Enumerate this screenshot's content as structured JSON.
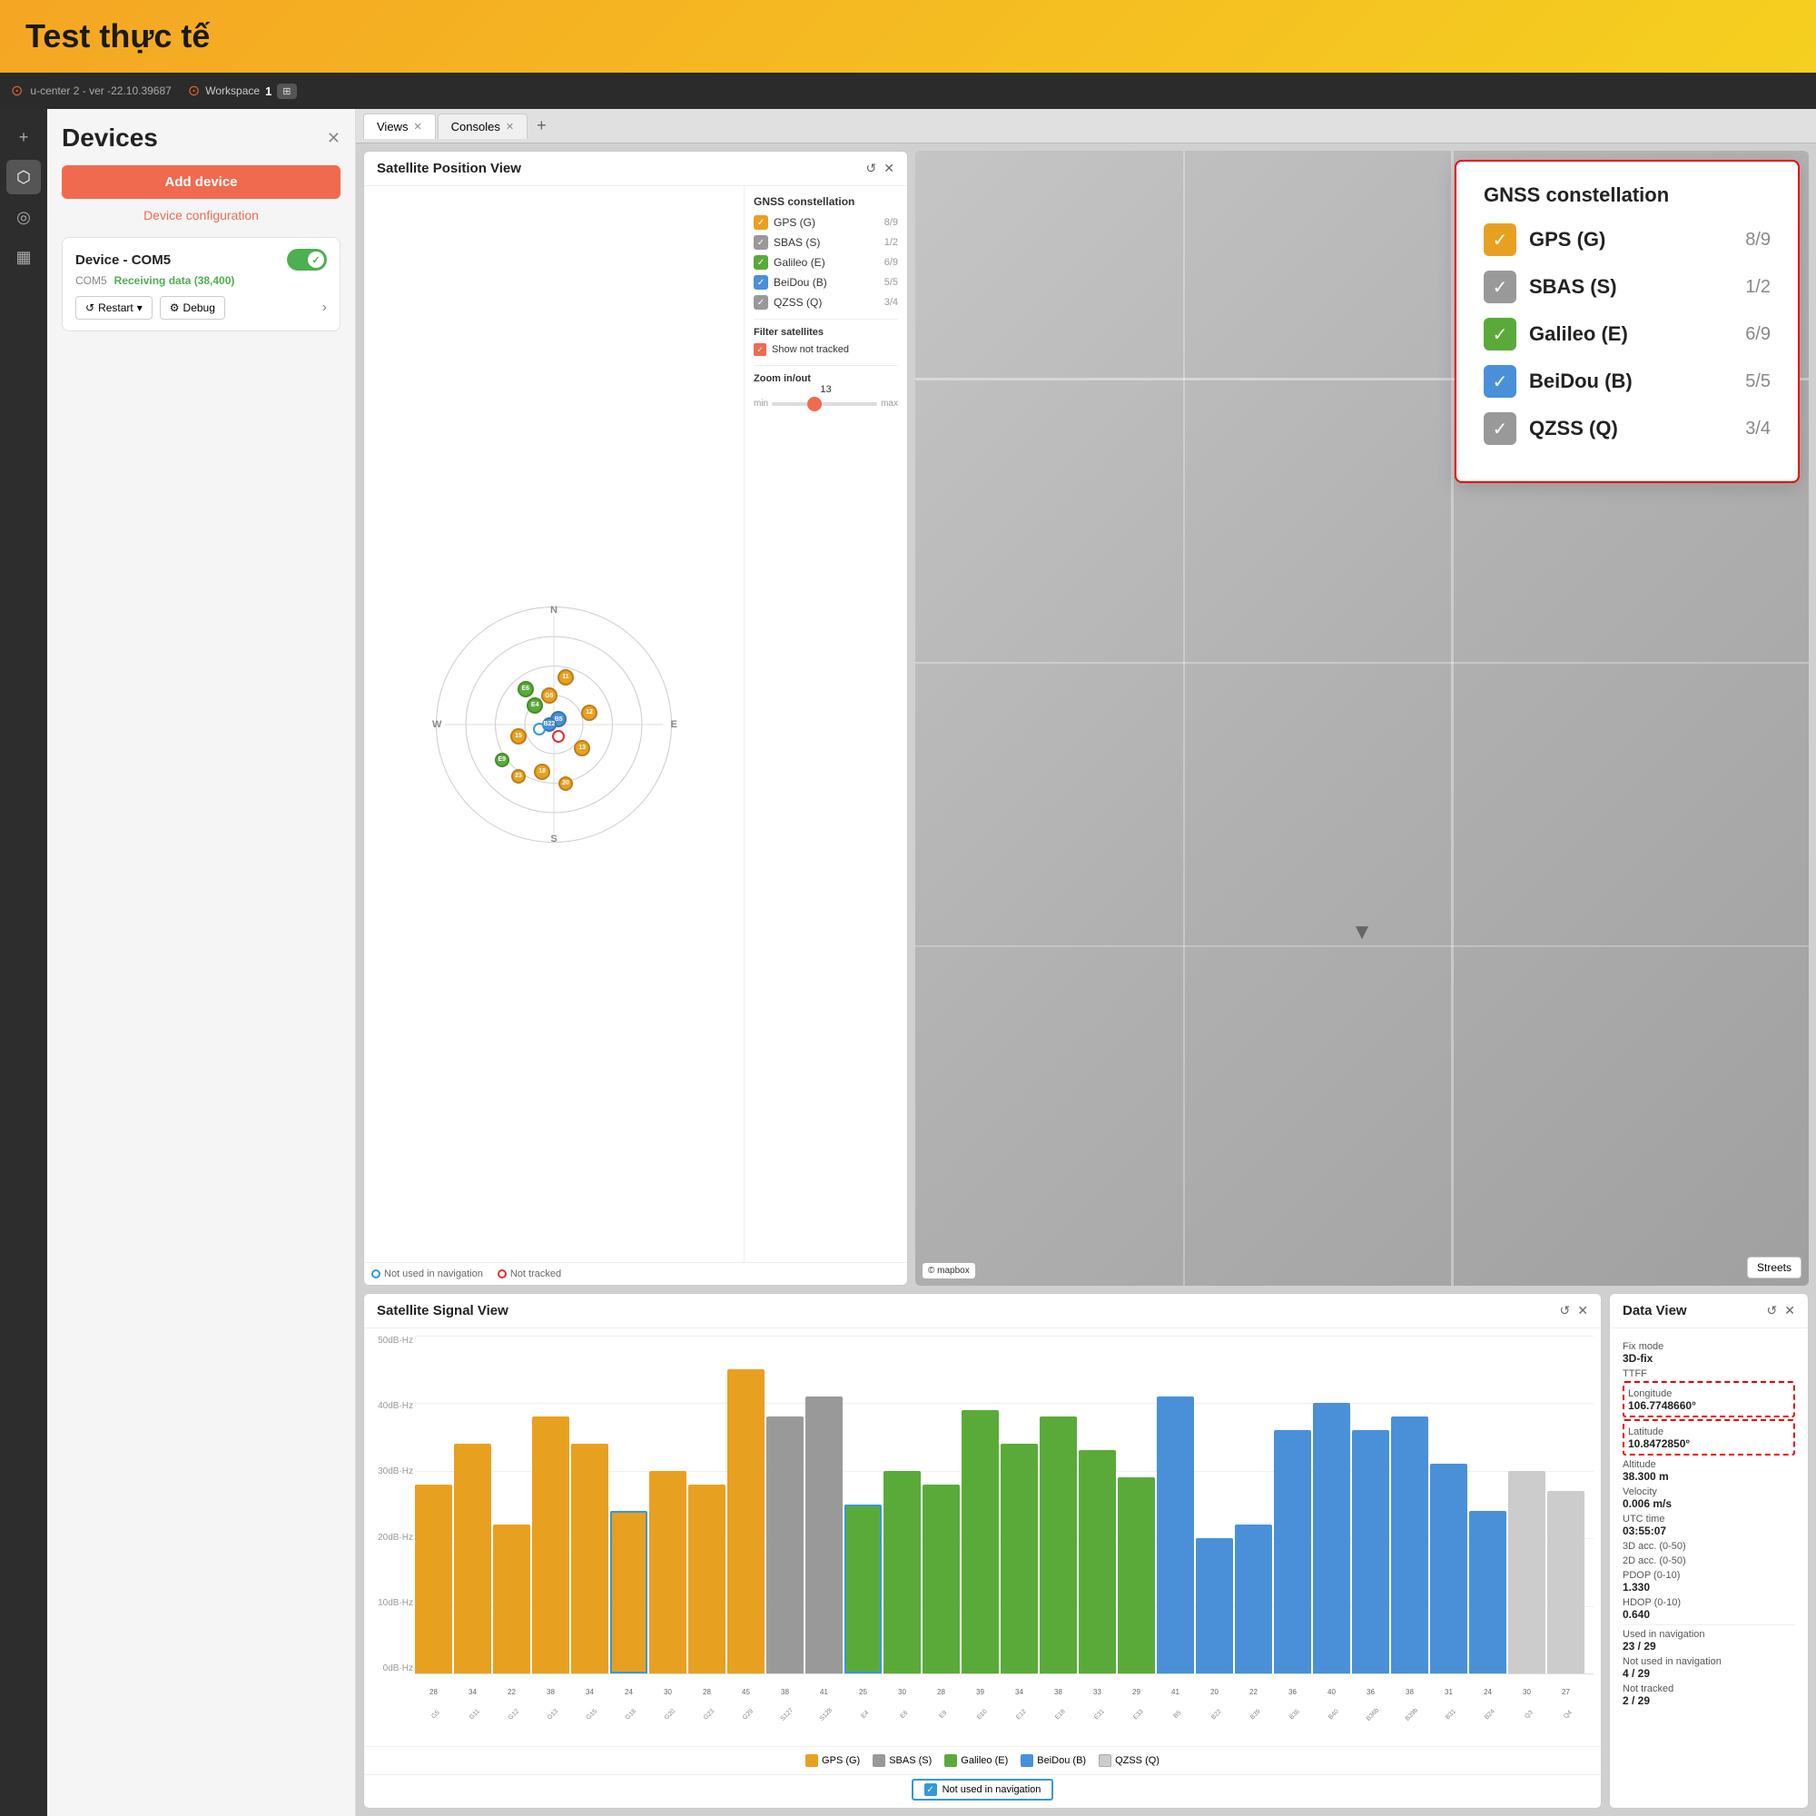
{
  "header": {
    "title": "Test thực tế"
  },
  "appbar": {
    "version": "u-center 2 - ver -22.10.39687",
    "workspace_label": "Workspace",
    "workspace_num": "1"
  },
  "sidebar": {
    "icons": [
      "plus",
      "chip",
      "settings",
      "briefcase"
    ]
  },
  "devices_panel": {
    "title": "Devices",
    "add_device_label": "Add device",
    "device_config_label": "Device configuration",
    "device": {
      "name": "Device - COM5",
      "port": "COM5",
      "status": "Receiving data (38,400)",
      "restart_label": "Restart",
      "debug_label": "Debug"
    }
  },
  "tabs": {
    "views_label": "Views",
    "consoles_label": "Consoles",
    "add_label": "+"
  },
  "sat_position_panel": {
    "title": "Satellite Position View",
    "gnss_title": "GNSS constellation",
    "constellations": [
      {
        "name": "GPS (G)",
        "count": "8/9",
        "color": "#e8a020"
      },
      {
        "name": "SBAS (S)",
        "count": "1/2",
        "color": "#999"
      },
      {
        "name": "Galileo (E)",
        "count": "6/9",
        "color": "#5aaa3a"
      },
      {
        "name": "BeiDou (B)",
        "count": "5/5",
        "color": "#4a90d9"
      },
      {
        "name": "QZSS (Q)",
        "count": "3/4",
        "color": "#999"
      }
    ],
    "filter_satellites": {
      "label": "Filter satellites",
      "show_not_tracked": "Show not tracked"
    },
    "zoom": {
      "label": "Zoom in/out",
      "value": "13",
      "min_label": "min",
      "max_label": "max"
    },
    "legend_not_used": "Not used in navigation",
    "legend_not_tracked": "Not tracked"
  },
  "gnss_popup": {
    "title": "GNSS constellation",
    "items": [
      {
        "name": "GPS (G)",
        "count": "8/9",
        "color": "#e8a020"
      },
      {
        "name": "SBAS (S)",
        "count": "1/2",
        "color": "#999"
      },
      {
        "name": "Galileo (E)",
        "count": "6/9",
        "color": "#5aaa3a"
      },
      {
        "name": "BeiDou (B)",
        "count": "5/5",
        "color": "#4a90d9"
      },
      {
        "name": "QZSS (Q)",
        "count": "3/4",
        "color": "#999"
      }
    ]
  },
  "sat_signal_panel": {
    "title": "Satellite Signal View",
    "y_axis": [
      "50dB·Hz",
      "40dB·Hz",
      "30dB·Hz",
      "20dB·Hz",
      "10dB·Hz",
      "0dB·Hz"
    ],
    "legend": [
      {
        "label": "GPS (G)",
        "color": "#e8a020"
      },
      {
        "label": "SBAS (S)",
        "color": "#999"
      },
      {
        "label": "Galileo (E)",
        "color": "#5aaa3a"
      },
      {
        "label": "BeiDou (B)",
        "color": "#4a90d9"
      },
      {
        "label": "QZSS (Q)",
        "color": "#ccc"
      }
    ],
    "not_nav_label": "Not used in navigation",
    "bars": [
      {
        "label": "G5",
        "value": 28,
        "color": "#e8a020",
        "tracked": true
      },
      {
        "label": "G11",
        "value": 34,
        "color": "#e8a020",
        "tracked": true
      },
      {
        "label": "G12",
        "value": 22,
        "color": "#e8a020",
        "tracked": true
      },
      {
        "label": "G13",
        "value": 38,
        "color": "#e8a020",
        "tracked": true
      },
      {
        "label": "G15",
        "value": 34,
        "color": "#e8a020",
        "tracked": true
      },
      {
        "label": "G18",
        "value": 24,
        "color": "#e8a020",
        "tracked": false
      },
      {
        "label": "G20",
        "value": 30,
        "color": "#e8a020",
        "tracked": true
      },
      {
        "label": "G23",
        "value": 28,
        "color": "#e8a020",
        "tracked": true
      },
      {
        "label": "G29",
        "value": 45,
        "color": "#e8a020",
        "tracked": true
      },
      {
        "label": "S127",
        "value": 38,
        "color": "#999",
        "tracked": true
      },
      {
        "label": "S128",
        "value": 41,
        "color": "#999",
        "tracked": true
      },
      {
        "label": "E4",
        "value": 25,
        "color": "#5aaa3a",
        "tracked": false
      },
      {
        "label": "E6",
        "value": 30,
        "color": "#5aaa3a",
        "tracked": true
      },
      {
        "label": "E9",
        "value": 28,
        "color": "#5aaa3a",
        "tracked": true
      },
      {
        "label": "E10",
        "value": 39,
        "color": "#5aaa3a",
        "tracked": true
      },
      {
        "label": "E12",
        "value": 34,
        "color": "#5aaa3a",
        "tracked": true
      },
      {
        "label": "E18",
        "value": 38,
        "color": "#5aaa3a",
        "tracked": true
      },
      {
        "label": "E31",
        "value": 33,
        "color": "#5aaa3a",
        "tracked": true
      },
      {
        "label": "E33",
        "value": 29,
        "color": "#5aaa3a",
        "tracked": true
      },
      {
        "label": "B5",
        "value": 41,
        "color": "#4a90d9",
        "tracked": true
      },
      {
        "label": "B22",
        "value": 20,
        "color": "#4a90d9",
        "tracked": true
      },
      {
        "label": "B39",
        "value": 22,
        "color": "#4a90d9",
        "tracked": true
      },
      {
        "label": "B36",
        "value": 36,
        "color": "#4a90d9",
        "tracked": true
      },
      {
        "label": "B40",
        "value": 40,
        "color": "#4a90d9",
        "tracked": true
      },
      {
        "label": "B36b",
        "value": 36,
        "color": "#4a90d9",
        "tracked": true
      },
      {
        "label": "B39b",
        "value": 38,
        "color": "#4a90d9",
        "tracked": true
      },
      {
        "label": "B31",
        "value": 31,
        "color": "#4a90d9",
        "tracked": true
      },
      {
        "label": "B24",
        "value": 24,
        "color": "#4a90d9",
        "tracked": true
      },
      {
        "label": "Q3",
        "value": 30,
        "color": "#ccc",
        "tracked": true
      },
      {
        "label": "Q4",
        "value": 27,
        "color": "#ccc",
        "tracked": true
      }
    ],
    "x_labels": [
      "G5",
      "G11",
      "G12",
      "G13",
      "G15",
      "G18",
      "G20",
      "G23",
      "G29",
      "S127",
      "S128",
      "E4",
      "E6",
      "E9",
      "E10",
      "E12",
      "E18",
      "E31",
      "E33",
      "B5",
      "B22",
      "B39",
      "B36",
      "B40",
      "B36b",
      "B39b",
      "B31",
      "B24",
      "Q3",
      "Q4"
    ],
    "db_labels": [
      "28",
      "34",
      "22",
      "38",
      "34",
      "24",
      "30",
      "28",
      "45",
      "38",
      "41",
      "25",
      "30",
      "28",
      "39",
      "34",
      "38",
      "33",
      "29",
      "41",
      "20",
      "22",
      "36",
      "40",
      "36",
      "38",
      "31",
      "24",
      "30",
      "27"
    ]
  },
  "data_view": {
    "title": "Data View",
    "fields": [
      {
        "label": "Fix mode",
        "value": "3D-fix"
      },
      {
        "label": "TTFF",
        "value": "",
        "highlight": false
      },
      {
        "label": "Longitude",
        "value": "106.7748660°",
        "highlight": true
      },
      {
        "label": "Latitude",
        "value": "10.8472850°",
        "highlight": true
      },
      {
        "label": "Altitude",
        "value": "38.300 m"
      },
      {
        "label": "Velocity",
        "value": "0.006 m/s"
      },
      {
        "label": "UTC time",
        "value": "03:55:07"
      },
      {
        "label": "3D acc. (0-50)",
        "value": ""
      },
      {
        "label": "2D acc. (0-50)",
        "value": ""
      },
      {
        "label": "PDOP (0-10)",
        "value": "1.330"
      },
      {
        "label": "HDOP (0-10)",
        "value": "0.640"
      },
      {
        "label": "Used in navigation",
        "value": "23 / 29"
      },
      {
        "label": "Not used in navigation",
        "value": "4 / 29"
      },
      {
        "label": "Not tracked",
        "value": "2 / 29"
      }
    ]
  },
  "map": {
    "mapbox_label": "© mapbox",
    "style_label": "Streets"
  }
}
